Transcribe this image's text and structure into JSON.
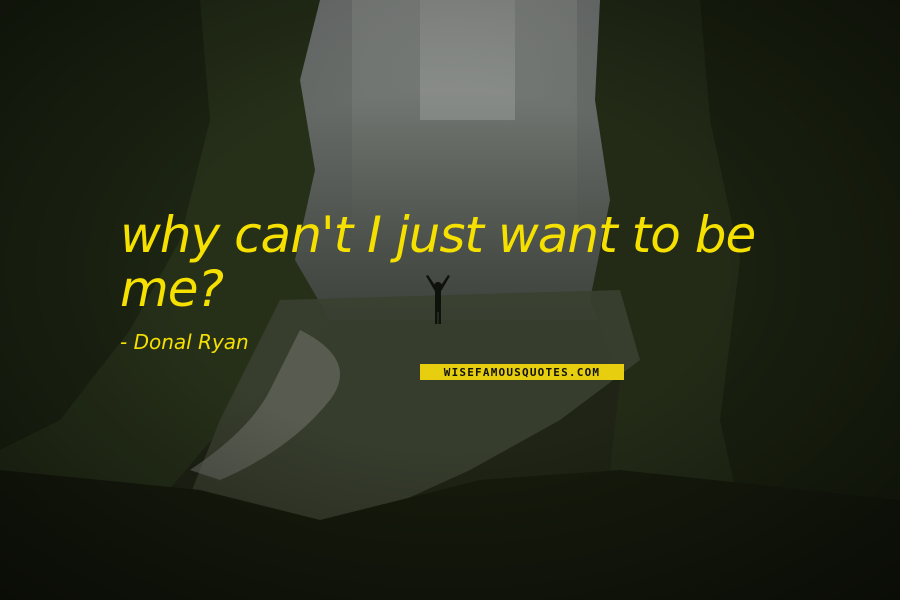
{
  "quote": {
    "text": "why can't I just want to be me?",
    "author": "- Donal Ryan"
  },
  "watermark": {
    "text": "WISEFAMOUSQUOTES.COM"
  },
  "colors": {
    "text": "#f5e000",
    "background": "#1f2416",
    "cliff_dark": "#151a0e",
    "waterfall": "#9a9d9a",
    "watermark_bg": "#e7cf10"
  }
}
